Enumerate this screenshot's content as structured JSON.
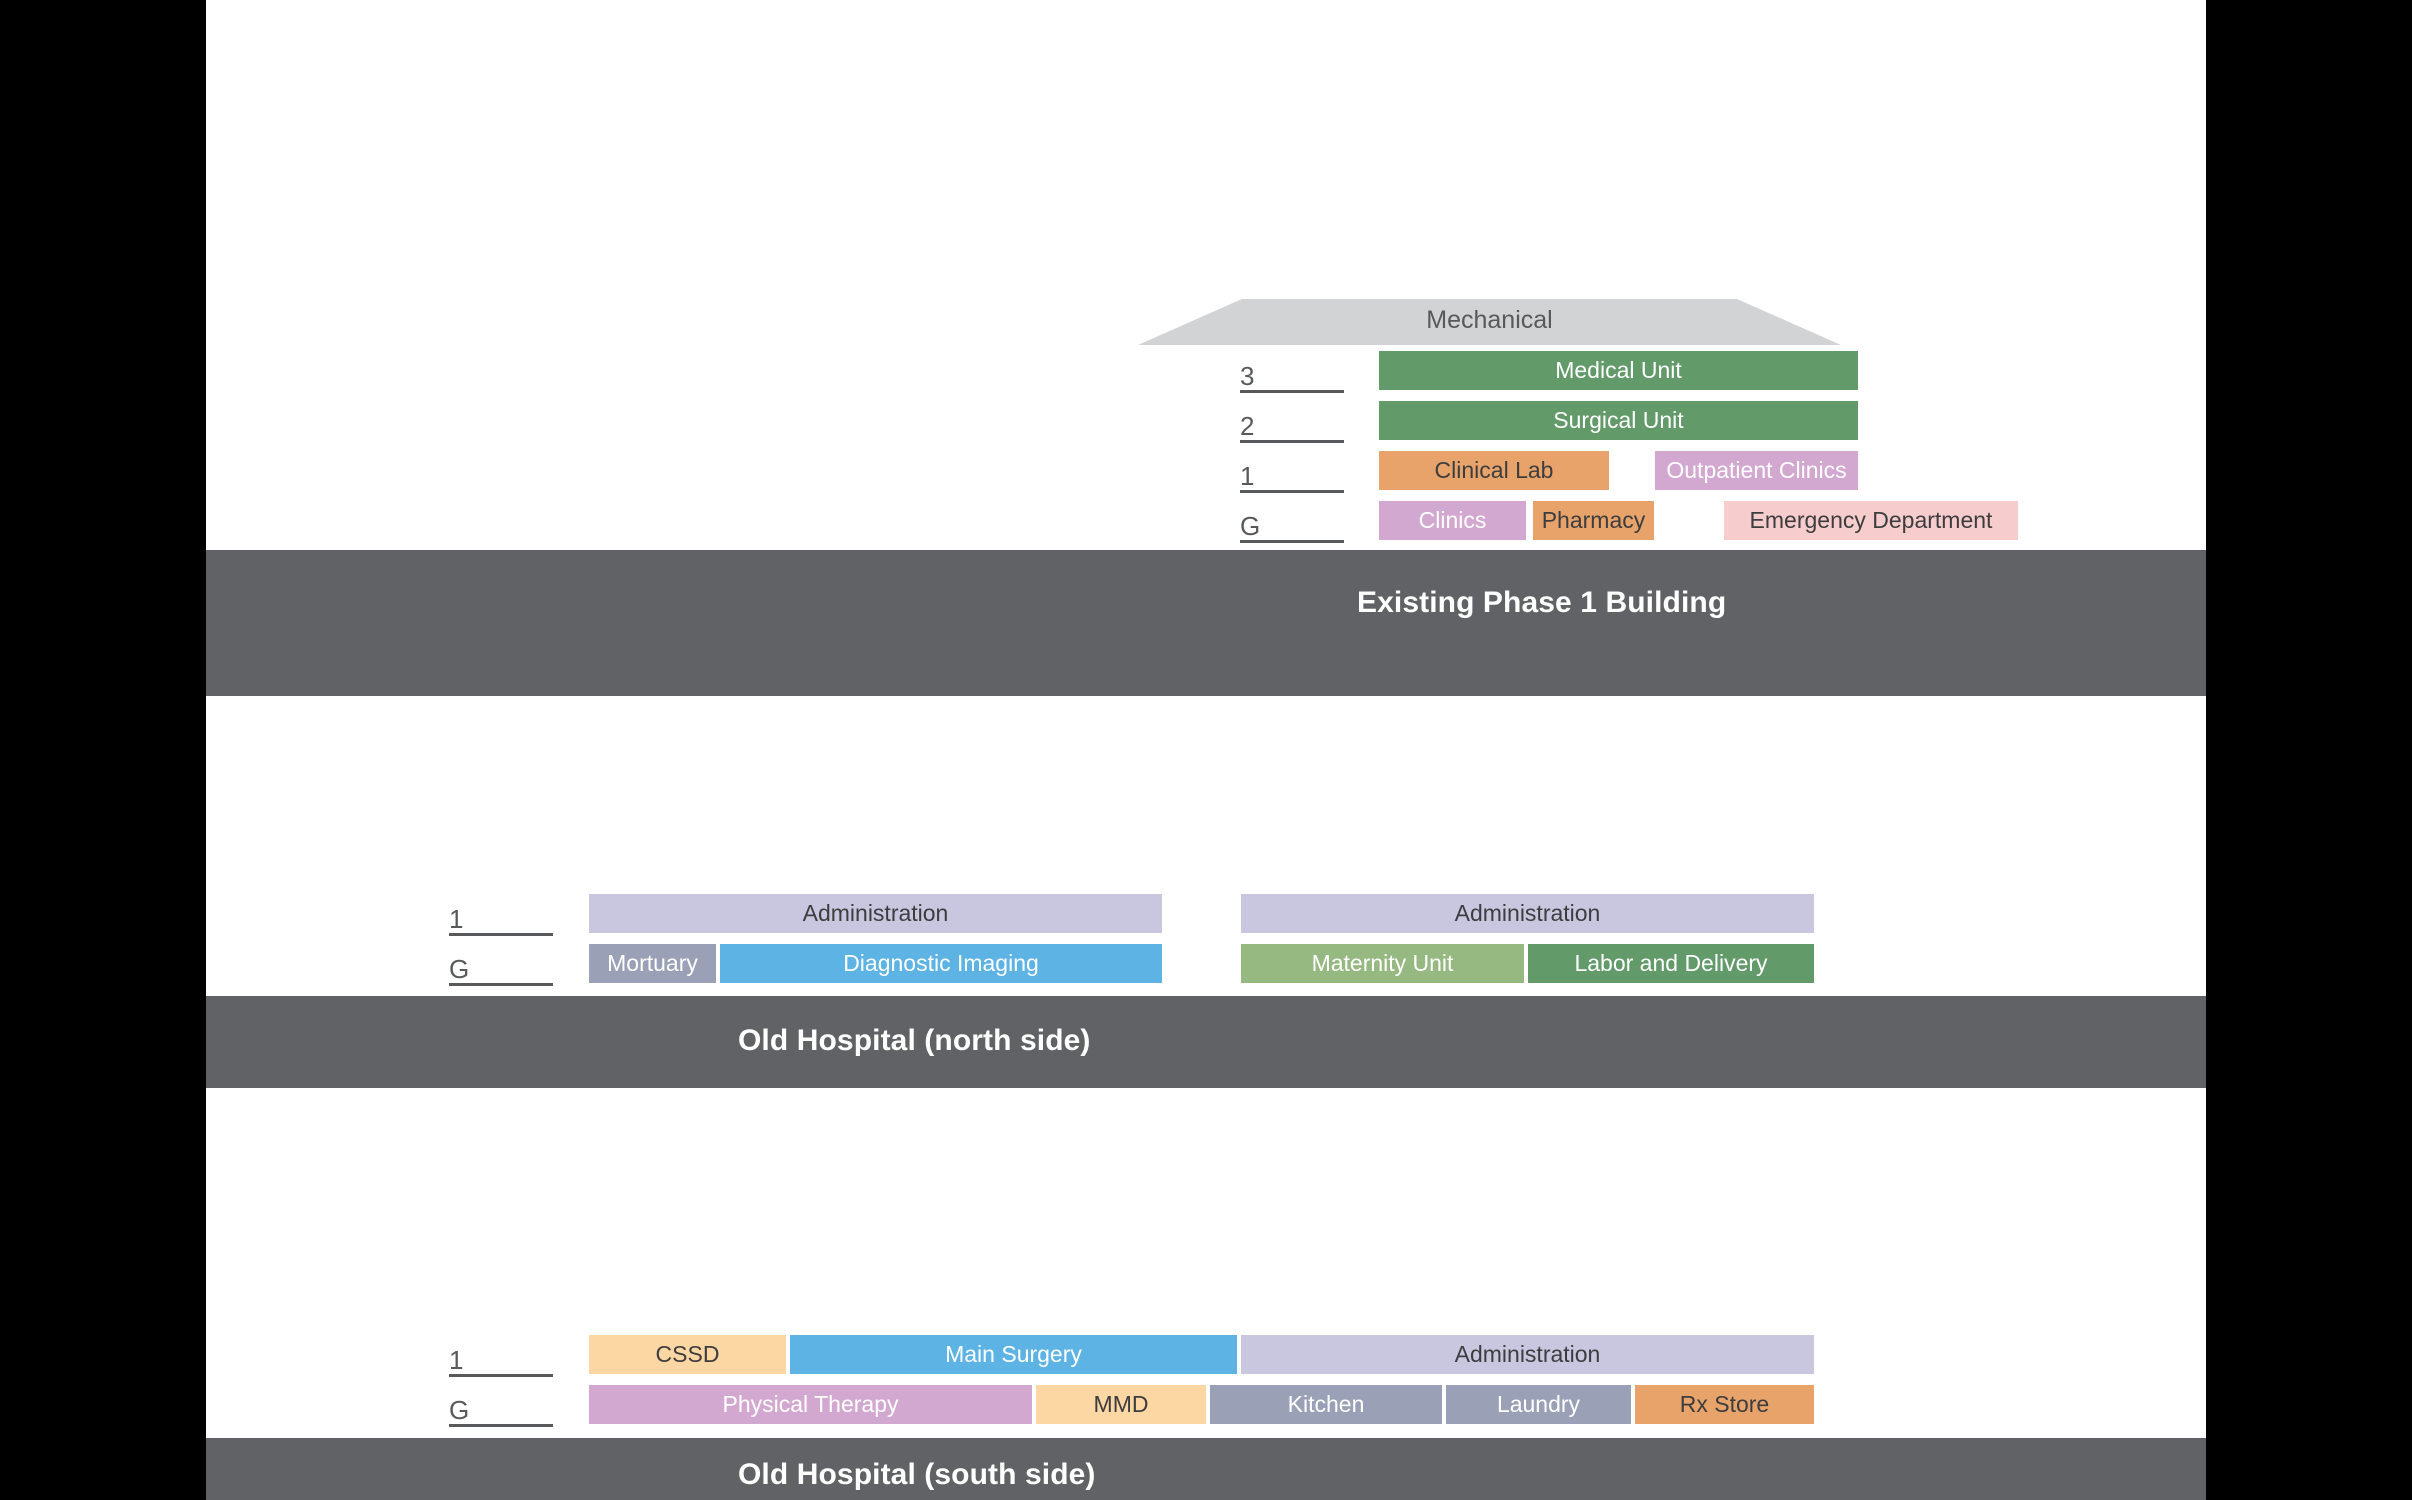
{
  "palette": {
    "canvas": "#ffffff",
    "letterbox": "#000000",
    "band": "#616265",
    "band_text": "#ffffff",
    "axis": "#58595b",
    "roof_fill": "#d2d3d4",
    "roof_text": "#58595b",
    "green_dark": "#629a6a",
    "green_light": "#96b881",
    "orange": "#e7a36a",
    "peach": "#fcd6a3",
    "orchid": "#d3a8d0",
    "lavender": "#c9c6e0",
    "blue": "#5cb3e4",
    "pink": "#f6cdcc",
    "slate": "#9aa0b5"
  },
  "sections": [
    {
      "id": "existing-phase-1-building",
      "band_label": "Existing Phase 1 Building",
      "roof": {
        "label": "Mechanical"
      },
      "floors": [
        {
          "label": "3"
        },
        {
          "label": "2"
        },
        {
          "label": "1"
        },
        {
          "label": "G"
        }
      ],
      "rooms": [
        {
          "label": "Medical Unit",
          "fill": "#629a6a",
          "text": "#ffffff",
          "floor": "3"
        },
        {
          "label": "Surgical Unit",
          "fill": "#629a6a",
          "text": "#ffffff",
          "floor": "2"
        },
        {
          "label": "Clinical Lab",
          "fill": "#e7a36a",
          "text": "#3d3d3f",
          "floor": "1"
        },
        {
          "label": "Outpatient Clinics",
          "fill": "#d3a8d0",
          "text": "#ffffff",
          "floor": "1"
        },
        {
          "label": "Clinics",
          "fill": "#d3a8d0",
          "text": "#ffffff",
          "floor": "G"
        },
        {
          "label": "Pharmacy",
          "fill": "#e7a36a",
          "text": "#3d3d3f",
          "floor": "G"
        },
        {
          "label": "Emergency Department",
          "fill": "#f6cdcc",
          "text": "#3d3d3f",
          "floor": "G"
        }
      ]
    },
    {
      "id": "old-hospital-north-side",
      "band_label": "Old Hospital (north side)",
      "floors": [
        {
          "label": "1"
        },
        {
          "label": "G"
        }
      ],
      "rooms": [
        {
          "label": "Administration",
          "fill": "#c9c6e0",
          "text": "#3d3d3f",
          "floor": "1"
        },
        {
          "label": "Administration",
          "fill": "#c9c6e0",
          "text": "#3d3d3f",
          "floor": "1"
        },
        {
          "label": "Mortuary",
          "fill": "#9aa0b5",
          "text": "#ffffff",
          "floor": "G"
        },
        {
          "label": "Diagnostic Imaging",
          "fill": "#5cb3e4",
          "text": "#ffffff",
          "floor": "G"
        },
        {
          "label": "Maternity Unit",
          "fill": "#96b881",
          "text": "#ffffff",
          "floor": "G"
        },
        {
          "label": "Labor and Delivery",
          "fill": "#629a6a",
          "text": "#ffffff",
          "floor": "G"
        }
      ]
    },
    {
      "id": "old-hospital-south-side",
      "band_label": "Old Hospital (south side)",
      "floors": [
        {
          "label": "1"
        },
        {
          "label": "G"
        }
      ],
      "rooms": [
        {
          "label": "CSSD",
          "fill": "#fcd6a3",
          "text": "#3d3d3f",
          "floor": "1"
        },
        {
          "label": "Main Surgery",
          "fill": "#5cb3e4",
          "text": "#ffffff",
          "floor": "1"
        },
        {
          "label": "Administration",
          "fill": "#c9c6e0",
          "text": "#3d3d3f",
          "floor": "1"
        },
        {
          "label": "Physical Therapy",
          "fill": "#d3a8d0",
          "text": "#ffffff",
          "floor": "G"
        },
        {
          "label": "MMD",
          "fill": "#fcd6a3",
          "text": "#3d3d3f",
          "floor": "G"
        },
        {
          "label": "Kitchen",
          "fill": "#9aa0b5",
          "text": "#ffffff",
          "floor": "G"
        },
        {
          "label": "Laundry",
          "fill": "#9aa0b5",
          "text": "#ffffff",
          "floor": "G"
        },
        {
          "label": "Rx Store",
          "fill": "#e7a36a",
          "text": "#3d3d3f",
          "floor": "G"
        }
      ]
    }
  ]
}
